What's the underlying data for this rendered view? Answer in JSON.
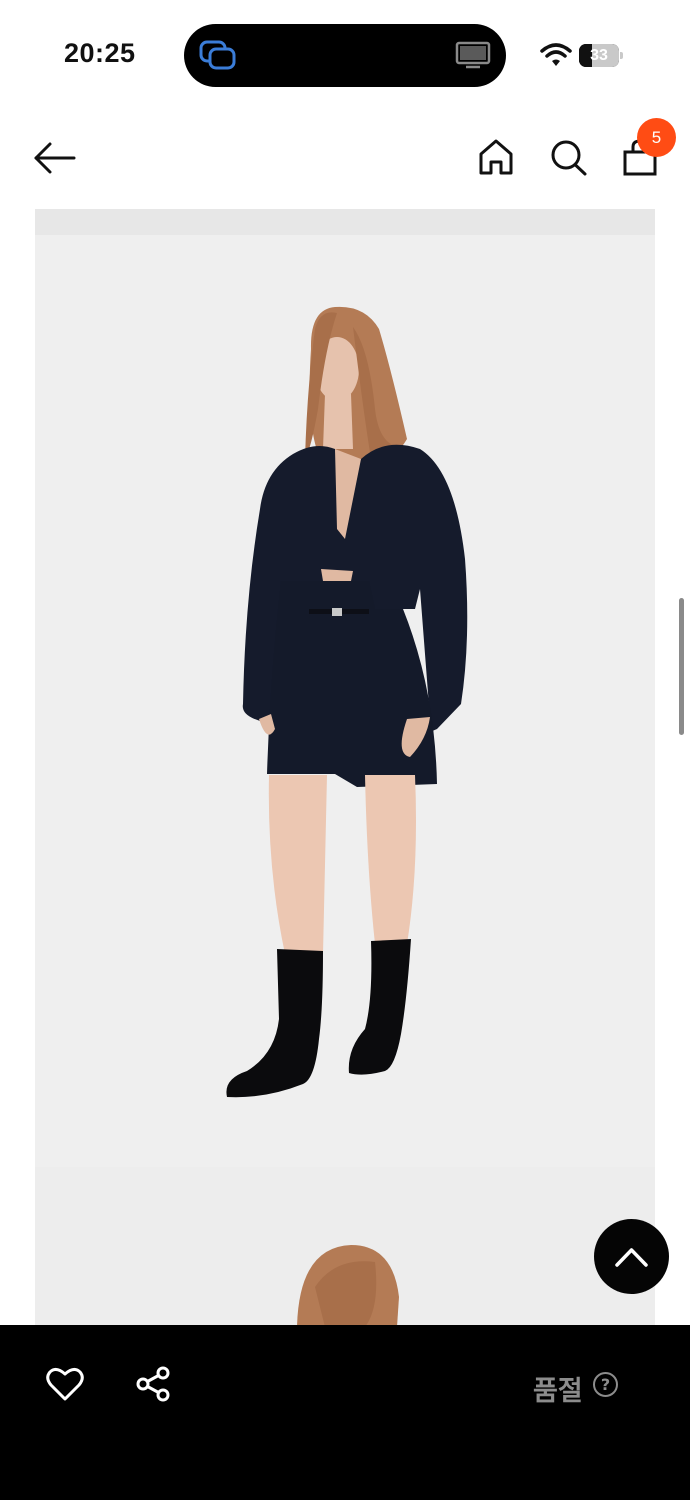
{
  "status_bar": {
    "time": "20:25",
    "battery_level": "33",
    "icons": [
      "screen-mirroring-icon",
      "tv-icon",
      "wifi-icon",
      "battery-icon"
    ]
  },
  "header": {
    "icons": [
      "back-arrow-icon",
      "home-icon",
      "search-icon",
      "shopping-bag-icon"
    ],
    "cart_count": "5",
    "badge_color": "#ff4c14"
  },
  "gallery": {
    "images": [
      "product-photo-model-full-body",
      "product-photo-model-partial"
    ]
  },
  "bottom_bar": {
    "icons": [
      "heart-icon",
      "share-icon",
      "help-icon"
    ],
    "status_label": "품절",
    "help_glyph": "?",
    "background": "#000000"
  },
  "scroll_top": {
    "icon": "chevron-up-icon"
  }
}
